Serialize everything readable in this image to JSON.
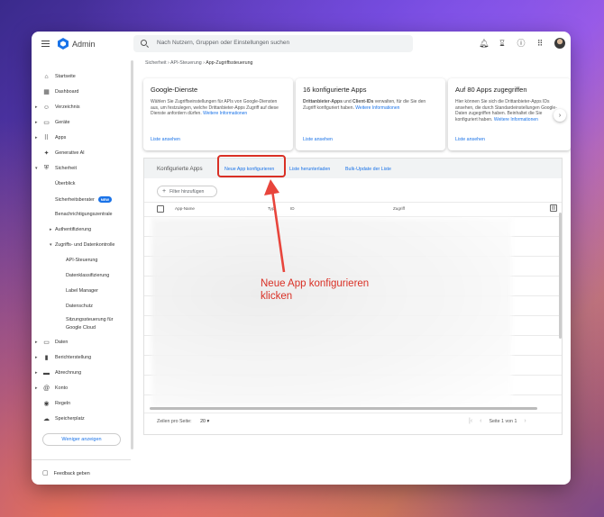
{
  "app": {
    "title": "Admin"
  },
  "search": {
    "placeholder": "Nach Nutzern, Gruppen oder Einstellungen suchen"
  },
  "topbar": {
    "icons": [
      "bell-icon",
      "hourglass-icon",
      "help-icon",
      "apps-grid-icon",
      "avatar"
    ]
  },
  "sidebar": {
    "items": [
      {
        "label": "Startseite"
      },
      {
        "label": "Dashboard"
      },
      {
        "label": "Verzeichnis"
      },
      {
        "label": "Geräte"
      },
      {
        "label": "Apps"
      },
      {
        "label": "Generative AI"
      },
      {
        "label": "Sicherheit"
      },
      {
        "label": "Überblick"
      },
      {
        "label": "Sicherheitsberater",
        "badge": "NEW"
      },
      {
        "label": "Benachrichtigungszentrale"
      },
      {
        "label": "Authentifizierung"
      },
      {
        "label": "Zugriffs- und Datenkontrolle"
      },
      {
        "label": "API-Steuerung"
      },
      {
        "label": "Datenklassifizierung"
      },
      {
        "label": "Label Manager"
      },
      {
        "label": "Datenschutz"
      },
      {
        "label": "Sitzungssteuerung für"
      },
      {
        "label": "Google Cloud"
      },
      {
        "label": "Daten"
      },
      {
        "label": "Berichterstellung"
      },
      {
        "label": "Abrechnung"
      },
      {
        "label": "Konto"
      },
      {
        "label": "Regeln"
      },
      {
        "label": "Speicherplatz"
      }
    ],
    "more_button": "Weniger anzeigen",
    "feedback": "Feedback geben"
  },
  "breadcrumb": {
    "items": [
      "Sicherheit",
      "API-Steuerung",
      "App-Zugriffssteuerung"
    ]
  },
  "cards": [
    {
      "title": "Google-Dienste",
      "text": "Wählen Sie Zugriffseinstellungen für APIs von Google-Diensten aus, um festzulegen, welche Drittanbieter-Apps Zugriff auf diese Dienste anfordern dürfen.",
      "inline_link": "Weitere Informationen",
      "bottom_link": "Liste ansehen"
    },
    {
      "title": "16 konfigurierte Apps",
      "text_bold": "Drittanbieter-Apps",
      "text_mid": " und ",
      "text_bold2": "Client-IDs",
      "text": " verwalten, für die Sie den Zugriff konfiguriert haben.",
      "inline_link": "Weitere Informationen",
      "bottom_link": "Liste ansehen"
    },
    {
      "title": "Auf 80 Apps zugegriffen",
      "text": "Hier können Sie sich die Drittanbieter-Apps IDs ansehen, die durch Standardeinstellungen Google-Daten zugegriffen haben. Beinhaltet die Sie konfiguriert haben.",
      "inline_link": "Weitere Informationen",
      "bottom_link": "Liste ansehen"
    }
  ],
  "panel": {
    "title": "Konfigurierte Apps",
    "links": [
      "Neue App konfigurieren",
      "Liste herunterladen",
      "Bulk-Update der Liste"
    ],
    "filter": "Filter hinzufügen",
    "columns": [
      "App-Name",
      "Typ",
      "ID",
      "Zugriff"
    ],
    "rows_per_page_label": "Zeilen pro Seite:",
    "rows_per_page_value": "20",
    "page_info": "Seite 1 von 1"
  },
  "annotation": {
    "line1": "Neue App konfigurieren",
    "line2": "klicken",
    "color": "#d93025"
  }
}
